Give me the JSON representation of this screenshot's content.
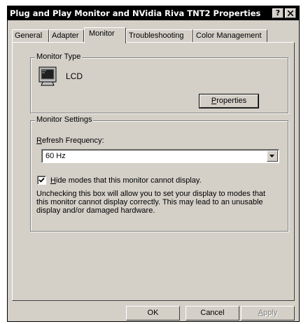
{
  "window": {
    "title": "Plug and Play Monitor and NVidia Riva TNT2 Properties",
    "help_button": "?",
    "close_button": "X"
  },
  "tabs": [
    {
      "label": "General",
      "active": false
    },
    {
      "label": "Adapter",
      "active": false
    },
    {
      "label": "Monitor",
      "active": true
    },
    {
      "label": "Troubleshooting",
      "active": false
    },
    {
      "label": "Color Management",
      "active": false
    }
  ],
  "monitor_type": {
    "legend": "Monitor Type",
    "name": "LCD",
    "icon": "monitor-icon",
    "properties_button": {
      "prefix": "",
      "underlined": "P",
      "rest": "roperties"
    }
  },
  "monitor_settings": {
    "legend": "Monitor Settings",
    "refresh_label": {
      "underlined": "R",
      "rest": "efresh Frequency:"
    },
    "refresh_value": "60 Hz",
    "hide_modes": {
      "checked": true,
      "underlined": "H",
      "rest": "ide modes that this monitor cannot display."
    },
    "description": "Unchecking this box will allow you to set your display to modes that this monitor cannot display correctly. This may lead to an unusable display and/or damaged hardware."
  },
  "buttons": {
    "ok": "OK",
    "cancel": "Cancel",
    "apply": {
      "underlined": "A",
      "rest": "pply",
      "disabled": true
    }
  }
}
